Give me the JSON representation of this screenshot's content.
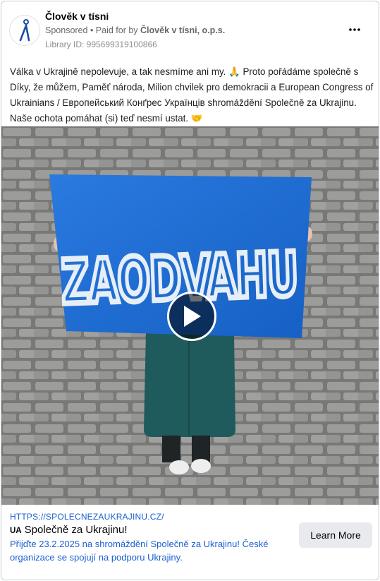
{
  "post": {
    "page_name": "Člověk v tísni",
    "sponsored": "Sponsored",
    "paid_prefix": " • Paid for by ",
    "paid_by": "Člověk v tísni, o.p.s.",
    "library_id": "Library ID: 995699319100866",
    "icons": {
      "avatar": "people-in-need-logo",
      "more": "more-options-icon",
      "play": "play-icon"
    },
    "text": "Válka v Ukrajině nepolevuje, a tak nesmíme ani my. 🙏  Proto pořádáme společně s Díky, že můžem, Paměť národa, Milion chvilek pro demokracii a European Congress of Ukrainians / Европейський Конґрес Українців shromáždění Společně za Ukrajinu. Naše ochota pomáhat (si) teď nesmí ustat. 🤝"
  },
  "media": {
    "sign_text": "ZAODVAHU",
    "colors": {
      "sign": "#1f6fd6",
      "coat": "#1f5a5c",
      "pavement": "#8e8e8c"
    }
  },
  "link": {
    "url": "HTTPS://SPOLECNEZAUKRAJINU.CZ/",
    "title_prefix": "UA",
    "title": "Společně za Ukrajinu!",
    "description": "Přijďte 23.2.2025 na shromáždění Společně za Ukrajinu! České organizace se spojují na podporu Ukrajiny.",
    "cta": "Learn More"
  }
}
